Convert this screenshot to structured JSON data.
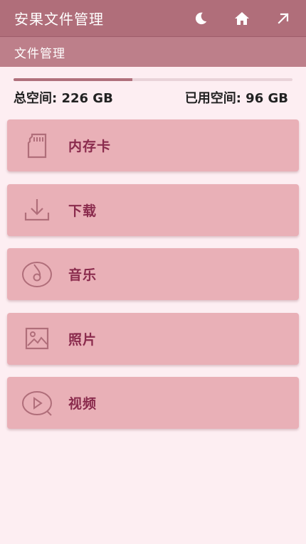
{
  "appbar": {
    "title": "安果文件管理",
    "icons": [
      "moon-icon",
      "home-icon",
      "arrow-up-right-icon"
    ]
  },
  "subbar": {
    "title": "文件管理"
  },
  "storage": {
    "total_label": "总空间: 226 GB",
    "used_label": "已用空间: 96 GB",
    "used_fraction": 0.425
  },
  "categories": [
    {
      "label": "内存卡",
      "icon": "sd-card-icon"
    },
    {
      "label": "下载",
      "icon": "download-icon"
    },
    {
      "label": "音乐",
      "icon": "music-icon"
    },
    {
      "label": "照片",
      "icon": "image-icon"
    },
    {
      "label": "视频",
      "icon": "video-icon"
    }
  ],
  "colors": {
    "appbar": "#b06e7a",
    "subbar": "#bd7f8a",
    "card": "#e9b0b7",
    "card_text": "#8a2b4d",
    "background": "#fdeef2"
  }
}
